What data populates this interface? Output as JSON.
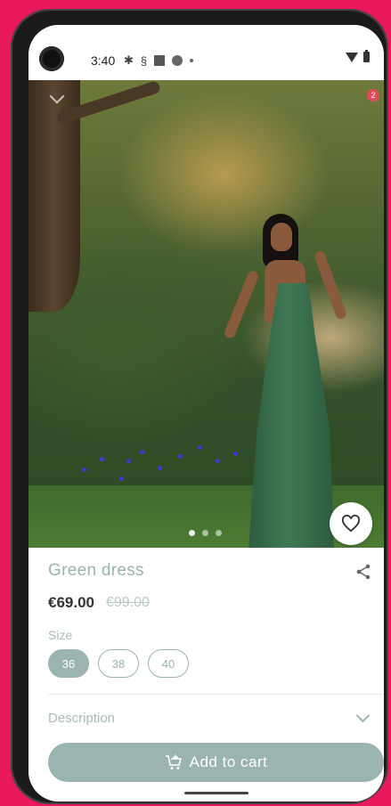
{
  "status_bar": {
    "time": "3:40",
    "notification_badge": "2"
  },
  "product": {
    "name": "Green dress",
    "price": "€69.00",
    "original_price": "€99.00",
    "image_pages": 3,
    "active_image_index": 0
  },
  "size": {
    "label": "Size",
    "options": [
      "36",
      "38",
      "40"
    ],
    "selected": "36"
  },
  "description": {
    "label": "Description"
  },
  "actions": {
    "add_to_cart_label": "Add to cart"
  },
  "colors": {
    "accent": "#9ab5b1",
    "frame": "#e8195a"
  },
  "icons": [
    "settings-icon",
    "wifi-icon",
    "battery-icon",
    "favorite-heart-icon",
    "share-icon",
    "chevron-down-icon",
    "add-cart-icon"
  ]
}
